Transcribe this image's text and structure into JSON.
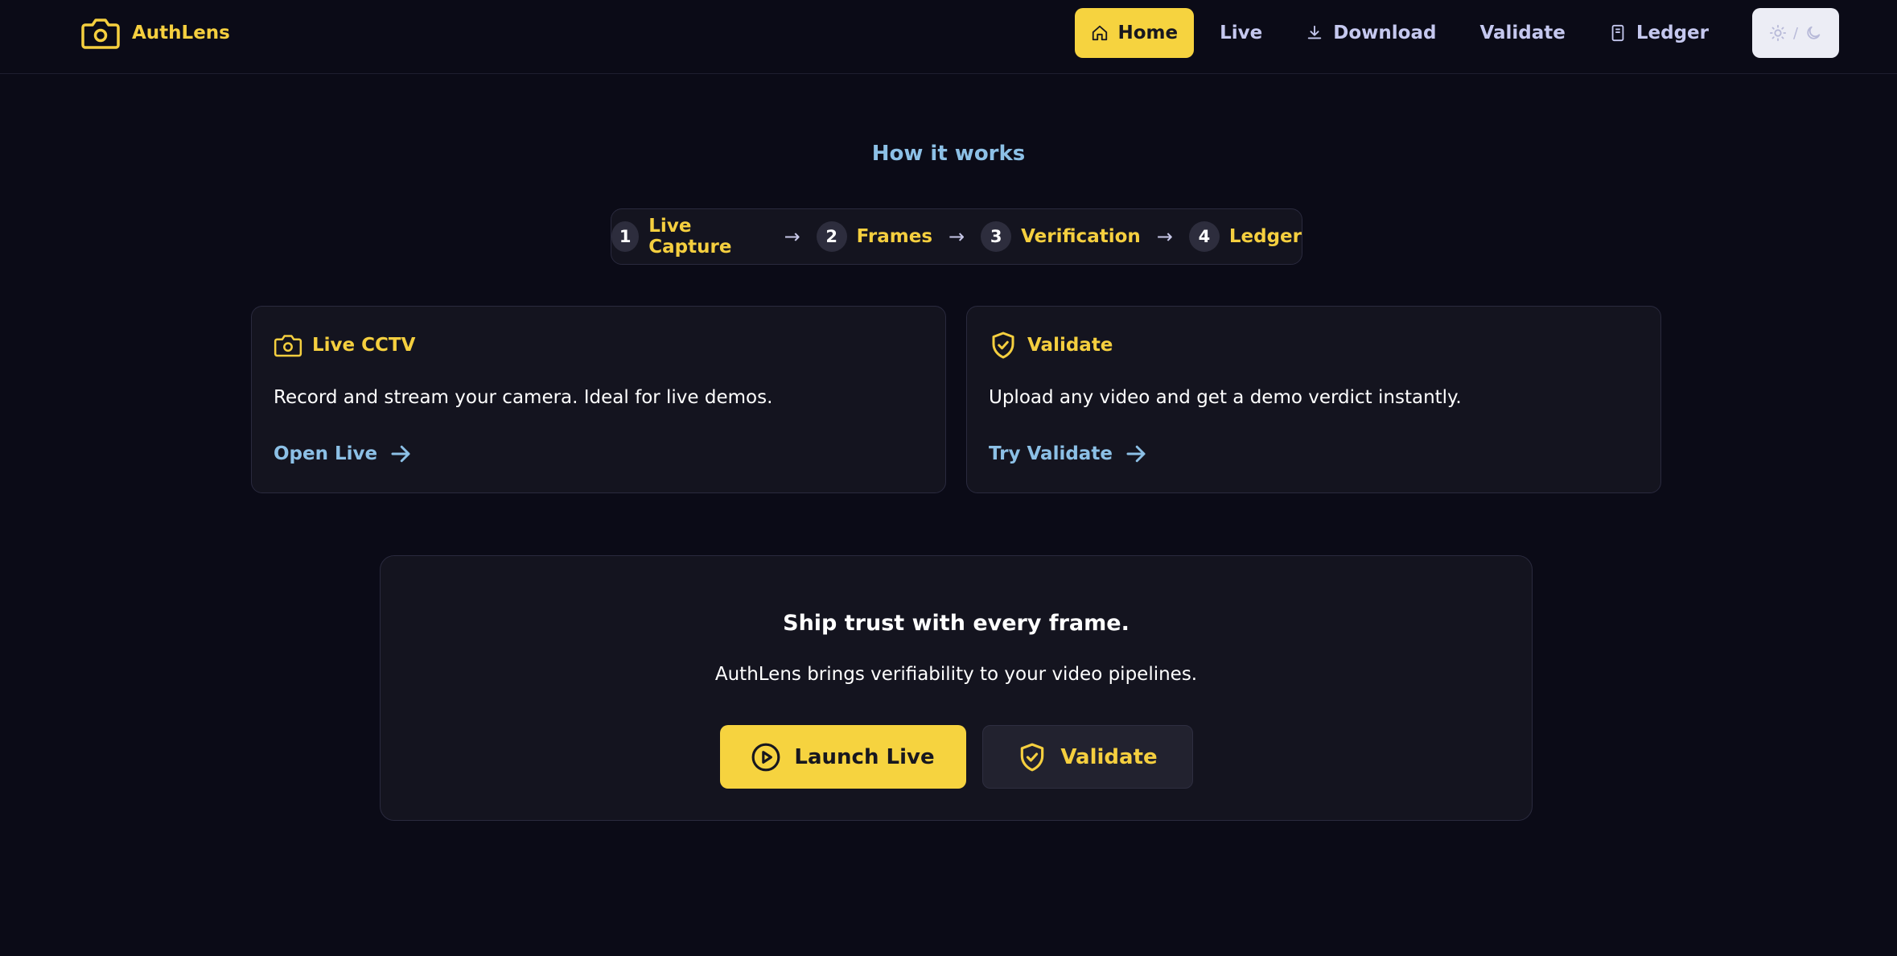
{
  "brand": {
    "name": "AuthLens",
    "icon": "camera-icon"
  },
  "nav": {
    "items": [
      {
        "label": "Home",
        "icon": "home-icon",
        "active": true
      },
      {
        "label": "Live",
        "icon": "",
        "active": false
      },
      {
        "label": "Download",
        "icon": "download-icon",
        "active": false
      },
      {
        "label": "Validate",
        "icon": "",
        "active": false
      },
      {
        "label": "Ledger",
        "icon": "book-icon",
        "active": false
      }
    ],
    "theme_toggle": {
      "separator": "/",
      "icons": [
        "sun-icon",
        "moon-icon"
      ]
    }
  },
  "how_it_works": {
    "title": "How it works",
    "steps": [
      {
        "num": "1",
        "label": "Live Capture"
      },
      {
        "num": "2",
        "label": "Frames"
      },
      {
        "num": "3",
        "label": "Verification"
      },
      {
        "num": "4",
        "label": "Ledger"
      }
    ]
  },
  "cards": [
    {
      "title": "Live CCTV",
      "icon": "camera-icon",
      "description": "Record and stream your camera. Ideal for live demos.",
      "link": "Open Live"
    },
    {
      "title": "Validate",
      "icon": "shield-check-icon",
      "description": "Upload any video and get a demo verdict instantly.",
      "link": "Try Validate"
    }
  ],
  "cta": {
    "title": "Ship trust with every frame.",
    "subtitle": "AuthLens brings verifiability to your video pipelines.",
    "primary_button": "Launch Live",
    "secondary_button": "Validate"
  },
  "colors": {
    "background": "#0b0b17",
    "accent": "#f6d33f",
    "link": "#8cc0e6",
    "nav_text": "#c5c8ef",
    "card_bg": "#14141f"
  }
}
